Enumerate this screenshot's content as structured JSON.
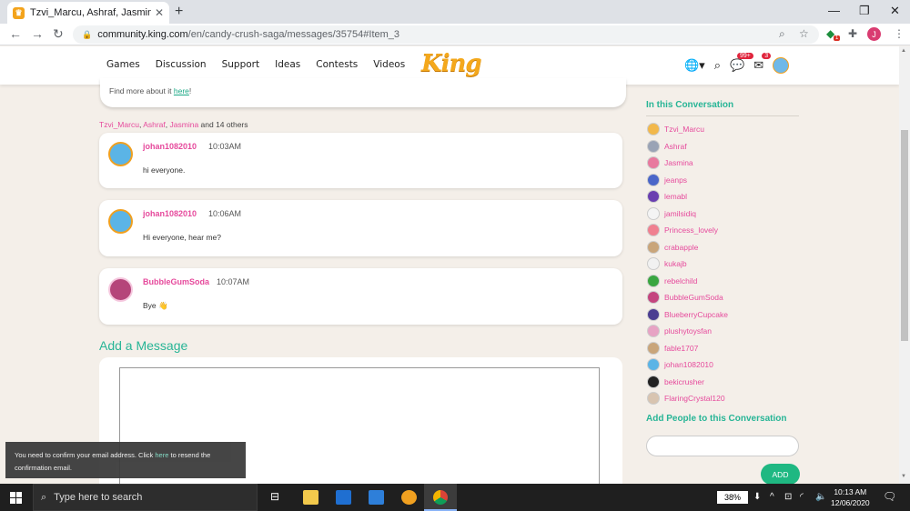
{
  "browser": {
    "tab_title": "Tzvi_Marcu, Ashraf, Jasmina and",
    "tab_close": "✕",
    "new_tab": "+",
    "url_domain": "community.king.com",
    "url_path": "/en/candy-crush-saga/messages/35754#Item_3",
    "profile_initial": "J",
    "extension_badge": "1"
  },
  "site": {
    "nav": [
      "Games",
      "Discussion",
      "Support",
      "Ideas",
      "Contests",
      "Videos"
    ],
    "logo": "King",
    "notifications_badge": "99+",
    "messages_badge": "3"
  },
  "info_box": {
    "prefix": "Find more about it ",
    "link": "here",
    "suffix": "!"
  },
  "conversation": {
    "participants_names": [
      "Tzvi_Marcu",
      "Ashraf",
      "Jasmina"
    ],
    "participants_rest": " and 14 others",
    "messages": [
      {
        "author": "johan1082010",
        "time": "10:03AM",
        "body": "hi everyone.",
        "avatar_color": "#5bb4e6"
      },
      {
        "author": "johan1082010",
        "time": "10:06AM",
        "body": "Hi everyone, hear me?",
        "avatar_color": "#5bb4e6"
      },
      {
        "author": "BubbleGumSoda",
        "time": "10:07AM",
        "body": "Bye",
        "avatar_color": "#b5457a"
      }
    ]
  },
  "add_message": {
    "title": "Add a Message"
  },
  "toast": {
    "before": "You need to confirm your email address. Click ",
    "link": "here",
    "after": " to resend the confirmation email."
  },
  "sidebar": {
    "in_conversation_title": "In this Conversation",
    "participants": [
      {
        "name": "Tzvi_Marcu",
        "color": "#f2b84b"
      },
      {
        "name": "Ashraf",
        "color": "#9aa3b5"
      },
      {
        "name": "Jasmina",
        "color": "#e8799e"
      },
      {
        "name": "jeanps",
        "color": "#4a66c9"
      },
      {
        "name": "lemabl",
        "color": "#6a3fb0"
      },
      {
        "name": "jamilsidiq",
        "color": "#f4f4f4"
      },
      {
        "name": "Princess_lovely",
        "color": "#f08090"
      },
      {
        "name": "crabapple",
        "color": "#c9a57a"
      },
      {
        "name": "kukajb",
        "color": "#f1f1f1"
      },
      {
        "name": "rebelchild",
        "color": "#3aa640"
      },
      {
        "name": "BubbleGumSoda",
        "color": "#c4457e"
      },
      {
        "name": "BlueberryCupcake",
        "color": "#4b3d91"
      },
      {
        "name": "plushytoysfan",
        "color": "#e7a3c4"
      },
      {
        "name": "fable1707",
        "color": "#c9a57a"
      },
      {
        "name": "johan1082010",
        "color": "#5bb4e6"
      },
      {
        "name": "bekicrusher",
        "color": "#222222"
      },
      {
        "name": "FlaringCrystal120",
        "color": "#d8c4b0"
      }
    ],
    "add_people_title": "Add People to this Conversation",
    "add_button": "ADD"
  },
  "taskbar": {
    "search_placeholder": "Type here to search",
    "battery": "38%",
    "time": "10:13 AM",
    "date": "12/06/2020"
  },
  "colors": {
    "accent_green": "#27b596",
    "pink_link": "#e64a9c",
    "add_button": "#1fb882"
  }
}
